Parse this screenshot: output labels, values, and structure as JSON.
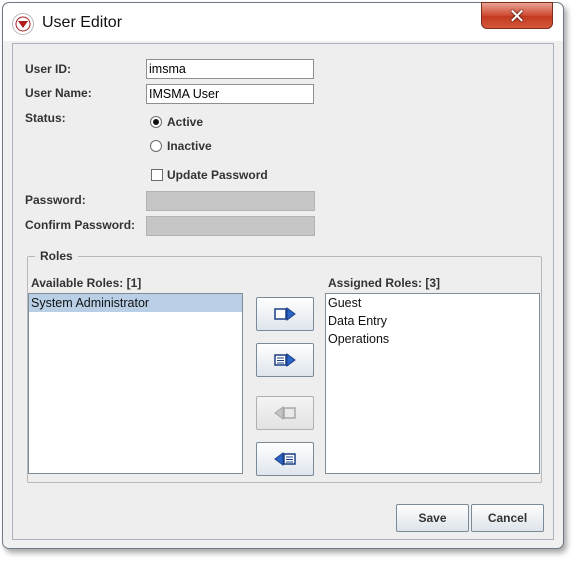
{
  "window": {
    "title": "User Editor",
    "close_glyph": "✕"
  },
  "form": {
    "user_id_label": "User ID:",
    "user_id_value": "imsma",
    "user_name_label": "User Name:",
    "user_name_value": "IMSMA User",
    "status_label": "Status:",
    "status_active_label": "Active",
    "status_inactive_label": "Inactive",
    "status_selected": "Active",
    "update_password_label": "Update Password",
    "update_password_checked": false,
    "password_label": "Password:",
    "confirm_password_label": "Confirm Password:"
  },
  "roles": {
    "group_title": "Roles",
    "available_label": "Available Roles: [1]",
    "assigned_label": "Assigned Roles: [3]",
    "available": [
      "System Administrator"
    ],
    "assigned": [
      "Guest",
      "Data Entry",
      "Operations"
    ],
    "available_selected": "System Administrator"
  },
  "actions": {
    "save_label": "Save",
    "cancel_label": "Cancel"
  },
  "icons": {
    "app": "imsma-logo-icon",
    "move_right": "move-right-icon",
    "move_all_right": "move-all-right-icon",
    "move_left": "move-left-icon",
    "move_all_left": "move-all-left-icon"
  },
  "colors": {
    "selection": "#b8cfe5",
    "close_button": "#c9432a"
  }
}
